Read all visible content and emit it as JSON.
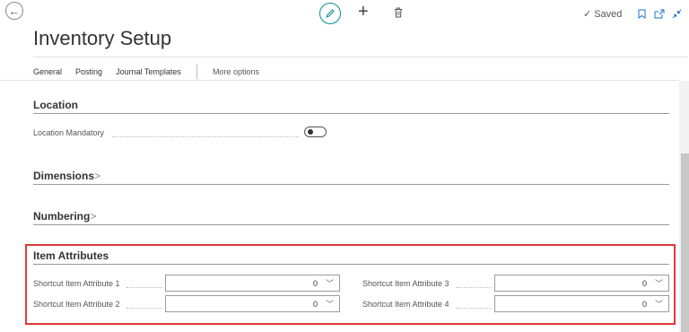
{
  "page": {
    "title": "Inventory Setup",
    "saved_label": "Saved"
  },
  "tabs": [
    "General",
    "Posting",
    "Journal Templates"
  ],
  "more_options": "More options",
  "location": {
    "title": "Location",
    "mandatory_label": "Location Mandatory",
    "mandatory_value": false
  },
  "dimensions": {
    "title": "Dimensions"
  },
  "numbering": {
    "title": "Numbering"
  },
  "item_attributes": {
    "title": "Item Attributes",
    "fields": [
      {
        "label": "Shortcut Item Attribute 1",
        "value": "0"
      },
      {
        "label": "Shortcut Item Attribute 2",
        "value": "0"
      },
      {
        "label": "Shortcut Item Attribute 3",
        "value": "0"
      },
      {
        "label": "Shortcut Item Attribute 4",
        "value": "0"
      }
    ]
  },
  "icons": {
    "back": "back-arrow-icon",
    "edit": "pencil-icon",
    "new": "plus-icon",
    "delete": "trash-icon",
    "saved": "check-icon",
    "bookmark": "bookmark-icon",
    "open_new_window": "open-in-new-window-icon",
    "collapse": "collapse-icon"
  },
  "colors": {
    "accent": "#0a8d8d",
    "highlight": "#e03a3a"
  }
}
